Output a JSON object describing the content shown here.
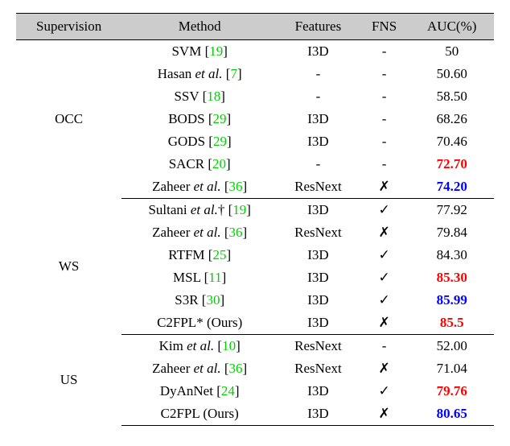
{
  "headers": {
    "supervision": "Supervision",
    "method": "Method",
    "features": "Features",
    "fns": "FNS",
    "auc": "AUC(%)"
  },
  "groups": [
    {
      "label": "OCC",
      "rows": [
        {
          "method_pre": "SVM [",
          "ref": "19",
          "method_post": "]",
          "features": "I3D",
          "fns": "-",
          "auc": "50",
          "auc_class": ""
        },
        {
          "method_pre": "Hasan ",
          "method_it": "et al.",
          "method_mid": " [",
          "ref": "7",
          "method_post": "]",
          "features": "-",
          "fns": "-",
          "auc": "50.60",
          "auc_class": ""
        },
        {
          "method_pre": "SSV [",
          "ref": "18",
          "method_post": "]",
          "features": "-",
          "fns": "-",
          "auc": "58.50",
          "auc_class": ""
        },
        {
          "method_pre": "BODS [",
          "ref": "29",
          "method_post": "]",
          "features": "I3D",
          "fns": "-",
          "auc": "68.26",
          "auc_class": ""
        },
        {
          "method_pre": "GODS [",
          "ref": "29",
          "method_post": "]",
          "features": "I3D",
          "fns": "-",
          "auc": "70.46",
          "auc_class": ""
        },
        {
          "method_pre": "SACR [",
          "ref": "20",
          "method_post": "]",
          "features": "-",
          "fns": "-",
          "auc": "72.70",
          "auc_class": "red"
        },
        {
          "method_pre": "Zaheer ",
          "method_it": "et al.",
          "method_mid": " [",
          "ref": "36",
          "method_post": "]",
          "features": "ResNext",
          "fns": "✗",
          "auc": "74.20",
          "auc_class": "blue"
        }
      ]
    },
    {
      "label": "WS",
      "rows": [
        {
          "method_pre": "Sultani ",
          "method_it": "et al.",
          "method_mid": "† [",
          "ref": "19",
          "method_post": "]",
          "features": "I3D",
          "fns": "✓",
          "auc": "77.92",
          "auc_class": ""
        },
        {
          "method_pre": "Zaheer ",
          "method_it": "et al.",
          "method_mid": " [",
          "ref": "36",
          "method_post": "]",
          "features": "ResNext",
          "fns": "✗",
          "auc": "79.84",
          "auc_class": ""
        },
        {
          "method_pre": "RTFM [",
          "ref": "25",
          "method_post": "]",
          "features": "I3D",
          "fns": "✓",
          "auc": "84.30",
          "auc_class": ""
        },
        {
          "method_pre": "MSL [",
          "ref": "11",
          "method_post": "]",
          "features": "I3D",
          "fns": "✓",
          "auc": "85.30",
          "auc_class": "red"
        },
        {
          "method_pre": "S3R [",
          "ref": "30",
          "method_post": "]",
          "features": "I3D",
          "fns": "✓",
          "auc": "85.99",
          "auc_class": "blue"
        },
        {
          "method_pre": "C2FPL* (Ours)",
          "method_post": "",
          "features": "I3D",
          "fns": "✗",
          "auc": "85.5",
          "auc_class": "red"
        }
      ]
    },
    {
      "label": "US",
      "rows": [
        {
          "method_pre": "Kim ",
          "method_it": "et al.",
          "method_mid": " [",
          "ref": "10",
          "method_post": "]",
          "features": "ResNext",
          "fns": "-",
          "auc": "52.00",
          "auc_class": ""
        },
        {
          "method_pre": "Zaheer ",
          "method_it": "et al.",
          "method_mid": " [",
          "ref": "36",
          "method_post": "]",
          "features": "ResNext",
          "fns": "✗",
          "auc": "71.04",
          "auc_class": ""
        },
        {
          "method_pre": "DyAnNet [",
          "ref": "24",
          "method_post": "]",
          "features": "I3D",
          "fns": "✓",
          "auc": "79.76",
          "auc_class": "red"
        },
        {
          "method_pre": "C2FPL (Ours)",
          "method_post": "",
          "features": "I3D",
          "fns": "✗",
          "auc": "80.65",
          "auc_class": "blue"
        }
      ]
    }
  ],
  "chart_data": {
    "type": "table",
    "title": "",
    "columns": [
      "Supervision",
      "Method",
      "Features",
      "FNS",
      "AUC(%)"
    ],
    "rows": [
      [
        "OCC",
        "SVM [19]",
        "I3D",
        "-",
        50
      ],
      [
        "OCC",
        "Hasan et al. [7]",
        "-",
        "-",
        50.6
      ],
      [
        "OCC",
        "SSV [18]",
        "-",
        "-",
        58.5
      ],
      [
        "OCC",
        "BODS [29]",
        "I3D",
        "-",
        68.26
      ],
      [
        "OCC",
        "GODS [29]",
        "I3D",
        "-",
        70.46
      ],
      [
        "OCC",
        "SACR [20]",
        "-",
        "-",
        72.7
      ],
      [
        "OCC",
        "Zaheer et al. [36]",
        "ResNext",
        "✗",
        74.2
      ],
      [
        "WS",
        "Sultani et al.† [19]",
        "I3D",
        "✓",
        77.92
      ],
      [
        "WS",
        "Zaheer et al. [36]",
        "ResNext",
        "✗",
        79.84
      ],
      [
        "WS",
        "RTFM [25]",
        "I3D",
        "✓",
        84.3
      ],
      [
        "WS",
        "MSL [11]",
        "I3D",
        "✓",
        85.3
      ],
      [
        "WS",
        "S3R [30]",
        "I3D",
        "✓",
        85.99
      ],
      [
        "WS",
        "C2FPL* (Ours)",
        "I3D",
        "✗",
        85.5
      ],
      [
        "US",
        "Kim et al. [10]",
        "ResNext",
        "-",
        52.0
      ],
      [
        "US",
        "Zaheer et al. [36]",
        "ResNext",
        "✗",
        71.04
      ],
      [
        "US",
        "DyAnNet [24]",
        "I3D",
        "✓",
        79.76
      ],
      [
        "US",
        "C2FPL (Ours)",
        "I3D",
        "✗",
        80.65
      ]
    ]
  }
}
